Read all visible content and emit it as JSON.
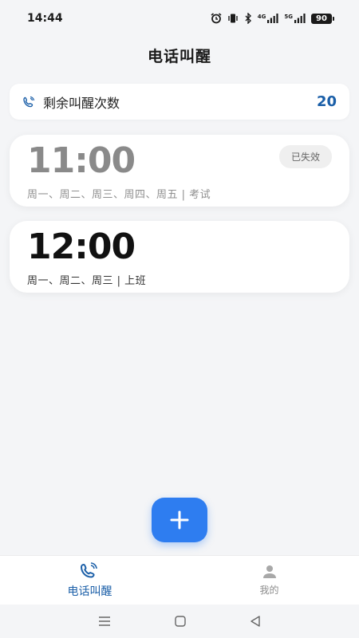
{
  "status_bar": {
    "time": "14:44",
    "network_1": "4G",
    "network_2": "5G",
    "battery": "90"
  },
  "page": {
    "title": "电话叫醒"
  },
  "remaining": {
    "label": "剩余叫醒次数",
    "count": "20"
  },
  "alarms": [
    {
      "time": "11:00",
      "description": "周一、周二、周三、周四、周五 | 考试",
      "status": "已失效",
      "enabled": false
    },
    {
      "time": "12:00",
      "description": "周一、周二、周三 | 上班",
      "enabled": true
    }
  ],
  "tabs": [
    {
      "label": "电话叫醒",
      "icon": "phone-ring-icon",
      "active": true
    },
    {
      "label": "我的",
      "icon": "person-icon",
      "active": false
    }
  ],
  "colors": {
    "accent": "#2e7df0",
    "link_blue": "#1b5fa8",
    "background": "#f4f5f7"
  }
}
